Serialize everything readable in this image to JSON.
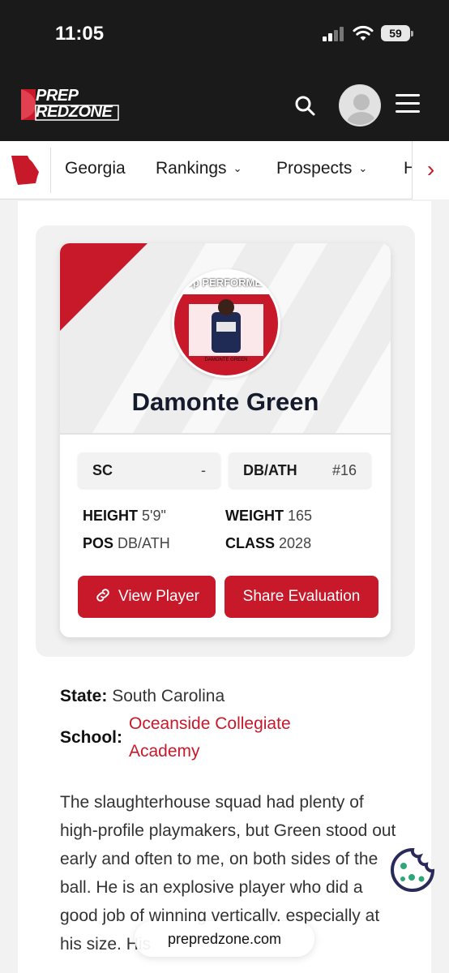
{
  "status_bar": {
    "time": "11:05",
    "battery": "59"
  },
  "header": {
    "logo_line1": "PREP",
    "logo_line2": "REDZONE"
  },
  "state_nav": {
    "items": [
      {
        "label": "Georgia"
      },
      {
        "label": "Rankings"
      },
      {
        "label": "Prospects"
      },
      {
        "label": "H"
      }
    ]
  },
  "player": {
    "photo_caption": "top PERFORMER",
    "photo_name": "DAMONTE GREEN",
    "name": "Damonte Green",
    "state_abbr": "SC",
    "state_rank": "-",
    "position_chip": "DB/ATH",
    "position_rank": "#16",
    "height_label": "HEIGHT",
    "height_value": "5'9\"",
    "weight_label": "WEIGHT",
    "weight_value": "165",
    "pos_label": "POS",
    "pos_value": "DB/ATH",
    "class_label": "CLASS",
    "class_value": "2028",
    "view_button": "View Player",
    "share_button": "Share Evaluation"
  },
  "details": {
    "state_label": "State:",
    "state_value": "South Carolina",
    "school_label": "School:",
    "school_line1": "Oceanside Collegiate",
    "school_line2": "Academy"
  },
  "bio": "The slaughterhouse squad had plenty of high-profile playmakers, but Green stood out early and often to me, on both sides of the ball. He is an explosive player who did a good job of winning vertically, especially at his size. His",
  "browser": {
    "url": "prepredzone.com"
  },
  "colors": {
    "brand": "#c8192b",
    "header_bg": "#1a1a1a"
  }
}
